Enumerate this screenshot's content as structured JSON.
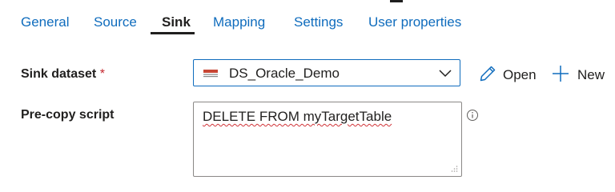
{
  "tabs": [
    {
      "label": "General"
    },
    {
      "label": "Source"
    },
    {
      "label": "Sink"
    },
    {
      "label": "Mapping"
    },
    {
      "label": "Settings"
    },
    {
      "label": "User properties"
    }
  ],
  "active_tab": "Sink",
  "sink_dataset": {
    "label": "Sink dataset",
    "required_marker": "*",
    "value": "DS_Oracle_Demo",
    "dataset_icon": "oracle-database-icon"
  },
  "actions": {
    "open_label": "Open",
    "new_label": "New",
    "open_icon": "pencil-icon",
    "new_icon": "plus-icon"
  },
  "pre_copy_script": {
    "label": "Pre-copy script",
    "value": "DELETE FROM myTargetTable",
    "info_icon": "info-icon"
  },
  "colors": {
    "accent": "#0f6cbd",
    "text": "#201f1e",
    "required": "#c4262e",
    "spellcheck": "#d13438",
    "border": "#8a8886"
  }
}
